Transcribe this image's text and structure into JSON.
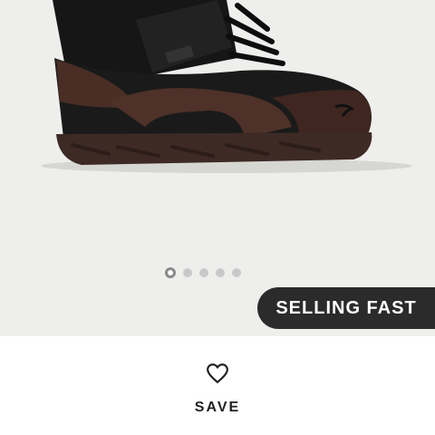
{
  "gallery": {
    "image_alt": "Black and brown leather high-top sneaker with strap",
    "slide_count": 5,
    "active_slide": 1
  },
  "badge": {
    "label": "SELLING FAST"
  },
  "actions": {
    "save_label": "SAVE",
    "save_icon": "heart-outline-icon"
  },
  "colors": {
    "hero_background": "#eeeeec",
    "badge_background": "#2b2b2b",
    "badge_text": "#ffffff"
  }
}
